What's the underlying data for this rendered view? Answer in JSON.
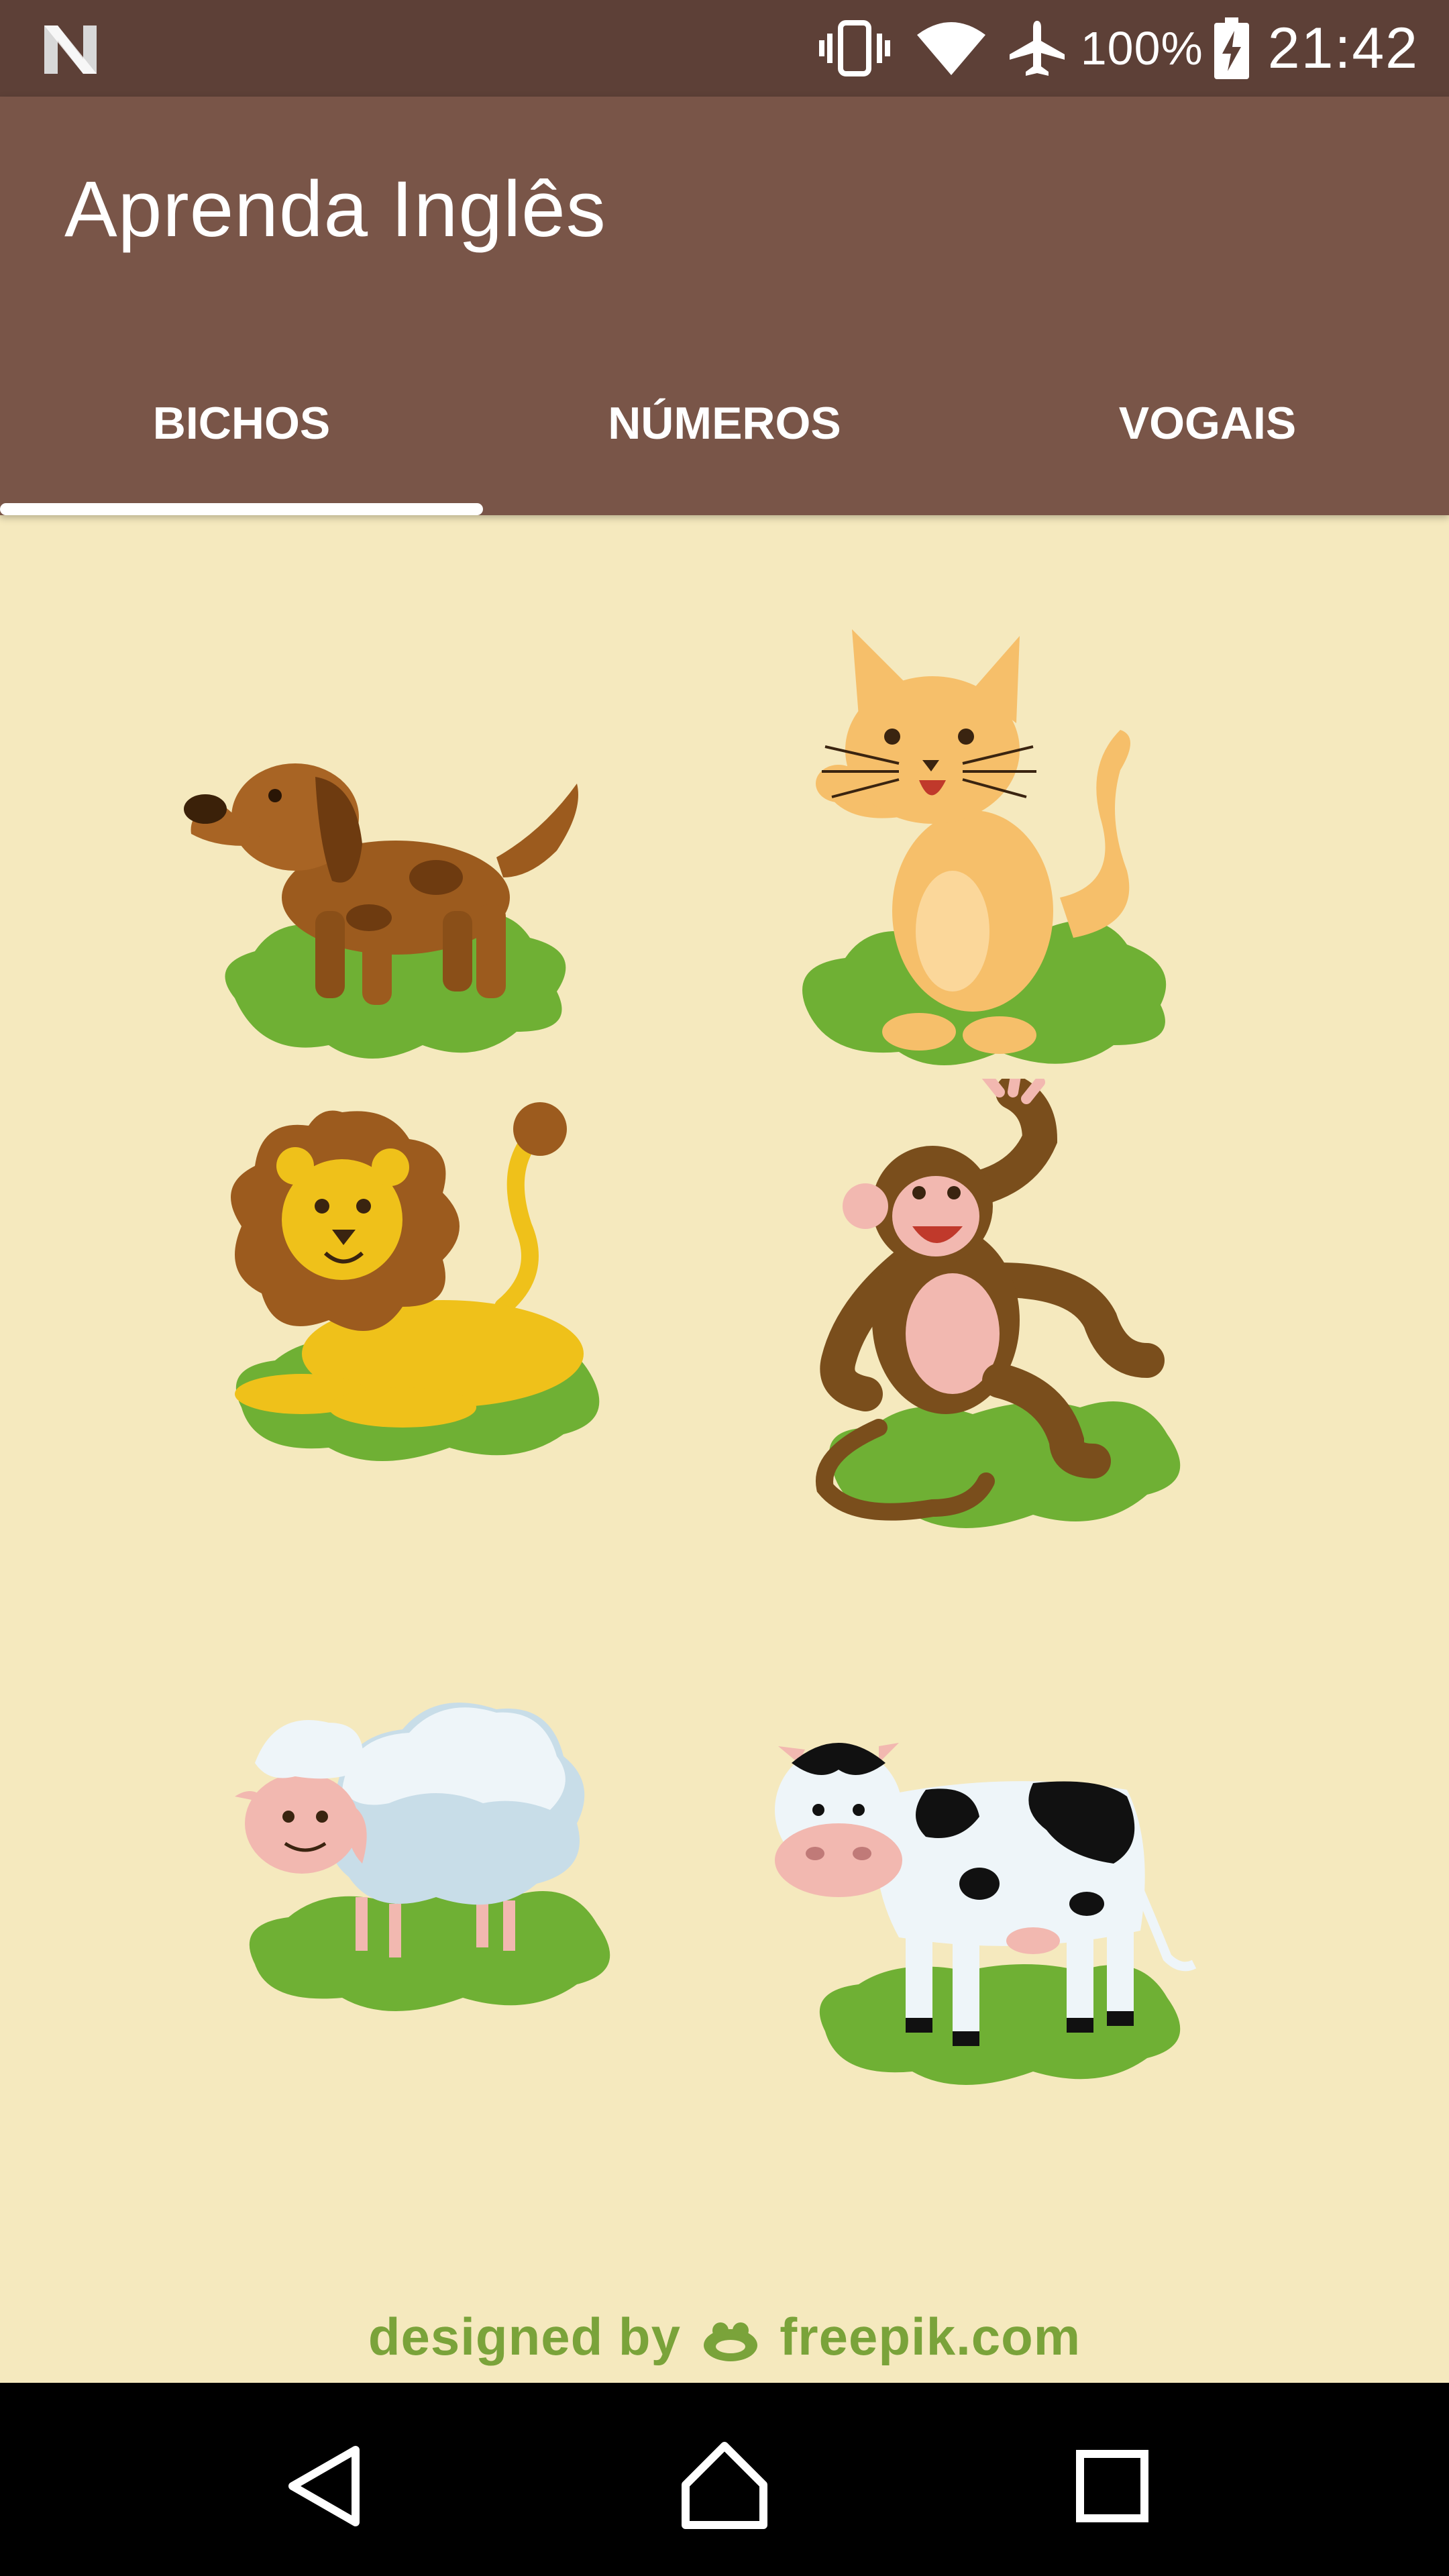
{
  "status_bar": {
    "battery_percent": "100%",
    "time": "21:42",
    "icons": [
      "n-logo-icon",
      "vibrate-icon",
      "wifi-icon",
      "airplane-icon",
      "battery-charging-icon"
    ]
  },
  "app_bar": {
    "title": "Aprenda Inglês",
    "background": "#795548"
  },
  "tabs": [
    {
      "label": "BICHOS",
      "selected": true
    },
    {
      "label": "NÚMEROS",
      "selected": false
    },
    {
      "label": "VOGAIS",
      "selected": false
    }
  ],
  "animals": [
    {
      "name": "dog"
    },
    {
      "name": "cat"
    },
    {
      "name": "lion"
    },
    {
      "name": "monkey"
    },
    {
      "name": "sheep"
    },
    {
      "name": "cow"
    }
  ],
  "footer": {
    "credit_prefix": "designed by",
    "credit_site": "freepik.com"
  },
  "nav_bar": {
    "buttons": [
      "back-icon",
      "home-icon",
      "recents-icon"
    ]
  },
  "colors": {
    "status_bar": "#5d4037",
    "app_bar": "#795548",
    "content_bg": "#f5e9be",
    "grass": "#6fb034"
  }
}
